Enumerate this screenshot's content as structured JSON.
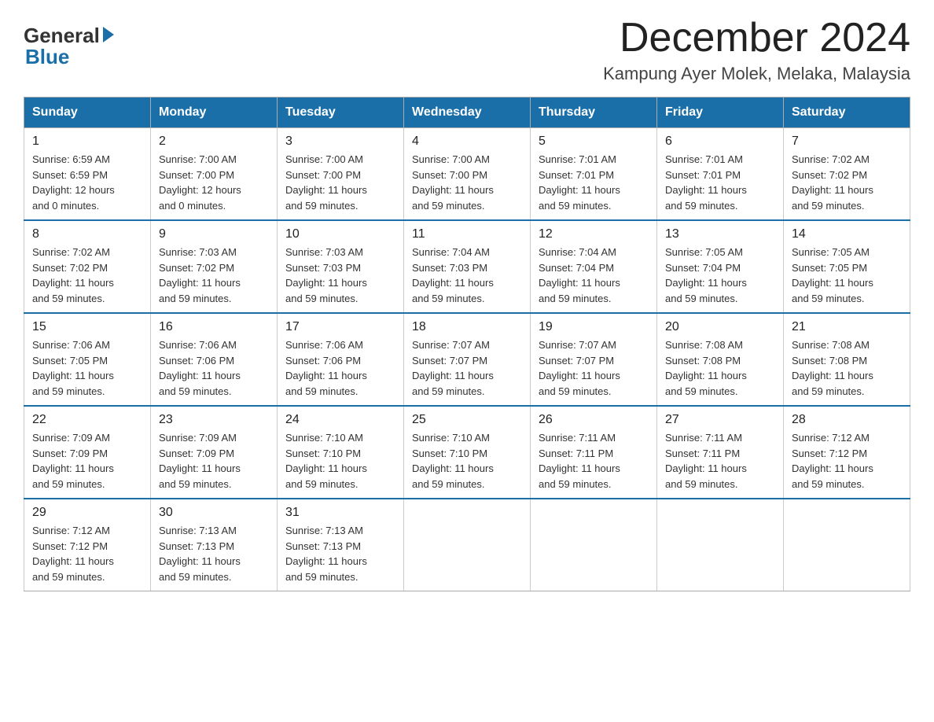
{
  "logo": {
    "general": "General",
    "blue": "Blue"
  },
  "title": "December 2024",
  "subtitle": "Kampung Ayer Molek, Melaka, Malaysia",
  "weekdays": [
    "Sunday",
    "Monday",
    "Tuesday",
    "Wednesday",
    "Thursday",
    "Friday",
    "Saturday"
  ],
  "weeks": [
    [
      {
        "day": "1",
        "sunrise": "6:59 AM",
        "sunset": "6:59 PM",
        "daylight": "12 hours and 0 minutes."
      },
      {
        "day": "2",
        "sunrise": "7:00 AM",
        "sunset": "7:00 PM",
        "daylight": "12 hours and 0 minutes."
      },
      {
        "day": "3",
        "sunrise": "7:00 AM",
        "sunset": "7:00 PM",
        "daylight": "11 hours and 59 minutes."
      },
      {
        "day": "4",
        "sunrise": "7:00 AM",
        "sunset": "7:00 PM",
        "daylight": "11 hours and 59 minutes."
      },
      {
        "day": "5",
        "sunrise": "7:01 AM",
        "sunset": "7:01 PM",
        "daylight": "11 hours and 59 minutes."
      },
      {
        "day": "6",
        "sunrise": "7:01 AM",
        "sunset": "7:01 PM",
        "daylight": "11 hours and 59 minutes."
      },
      {
        "day": "7",
        "sunrise": "7:02 AM",
        "sunset": "7:02 PM",
        "daylight": "11 hours and 59 minutes."
      }
    ],
    [
      {
        "day": "8",
        "sunrise": "7:02 AM",
        "sunset": "7:02 PM",
        "daylight": "11 hours and 59 minutes."
      },
      {
        "day": "9",
        "sunrise": "7:03 AM",
        "sunset": "7:02 PM",
        "daylight": "11 hours and 59 minutes."
      },
      {
        "day": "10",
        "sunrise": "7:03 AM",
        "sunset": "7:03 PM",
        "daylight": "11 hours and 59 minutes."
      },
      {
        "day": "11",
        "sunrise": "7:04 AM",
        "sunset": "7:03 PM",
        "daylight": "11 hours and 59 minutes."
      },
      {
        "day": "12",
        "sunrise": "7:04 AM",
        "sunset": "7:04 PM",
        "daylight": "11 hours and 59 minutes."
      },
      {
        "day": "13",
        "sunrise": "7:05 AM",
        "sunset": "7:04 PM",
        "daylight": "11 hours and 59 minutes."
      },
      {
        "day": "14",
        "sunrise": "7:05 AM",
        "sunset": "7:05 PM",
        "daylight": "11 hours and 59 minutes."
      }
    ],
    [
      {
        "day": "15",
        "sunrise": "7:06 AM",
        "sunset": "7:05 PM",
        "daylight": "11 hours and 59 minutes."
      },
      {
        "day": "16",
        "sunrise": "7:06 AM",
        "sunset": "7:06 PM",
        "daylight": "11 hours and 59 minutes."
      },
      {
        "day": "17",
        "sunrise": "7:06 AM",
        "sunset": "7:06 PM",
        "daylight": "11 hours and 59 minutes."
      },
      {
        "day": "18",
        "sunrise": "7:07 AM",
        "sunset": "7:07 PM",
        "daylight": "11 hours and 59 minutes."
      },
      {
        "day": "19",
        "sunrise": "7:07 AM",
        "sunset": "7:07 PM",
        "daylight": "11 hours and 59 minutes."
      },
      {
        "day": "20",
        "sunrise": "7:08 AM",
        "sunset": "7:08 PM",
        "daylight": "11 hours and 59 minutes."
      },
      {
        "day": "21",
        "sunrise": "7:08 AM",
        "sunset": "7:08 PM",
        "daylight": "11 hours and 59 minutes."
      }
    ],
    [
      {
        "day": "22",
        "sunrise": "7:09 AM",
        "sunset": "7:09 PM",
        "daylight": "11 hours and 59 minutes."
      },
      {
        "day": "23",
        "sunrise": "7:09 AM",
        "sunset": "7:09 PM",
        "daylight": "11 hours and 59 minutes."
      },
      {
        "day": "24",
        "sunrise": "7:10 AM",
        "sunset": "7:10 PM",
        "daylight": "11 hours and 59 minutes."
      },
      {
        "day": "25",
        "sunrise": "7:10 AM",
        "sunset": "7:10 PM",
        "daylight": "11 hours and 59 minutes."
      },
      {
        "day": "26",
        "sunrise": "7:11 AM",
        "sunset": "7:11 PM",
        "daylight": "11 hours and 59 minutes."
      },
      {
        "day": "27",
        "sunrise": "7:11 AM",
        "sunset": "7:11 PM",
        "daylight": "11 hours and 59 minutes."
      },
      {
        "day": "28",
        "sunrise": "7:12 AM",
        "sunset": "7:12 PM",
        "daylight": "11 hours and 59 minutes."
      }
    ],
    [
      {
        "day": "29",
        "sunrise": "7:12 AM",
        "sunset": "7:12 PM",
        "daylight": "11 hours and 59 minutes."
      },
      {
        "day": "30",
        "sunrise": "7:13 AM",
        "sunset": "7:13 PM",
        "daylight": "11 hours and 59 minutes."
      },
      {
        "day": "31",
        "sunrise": "7:13 AM",
        "sunset": "7:13 PM",
        "daylight": "11 hours and 59 minutes."
      },
      null,
      null,
      null,
      null
    ]
  ],
  "labels": {
    "sunrise": "Sunrise:",
    "sunset": "Sunset:",
    "daylight": "Daylight:"
  }
}
